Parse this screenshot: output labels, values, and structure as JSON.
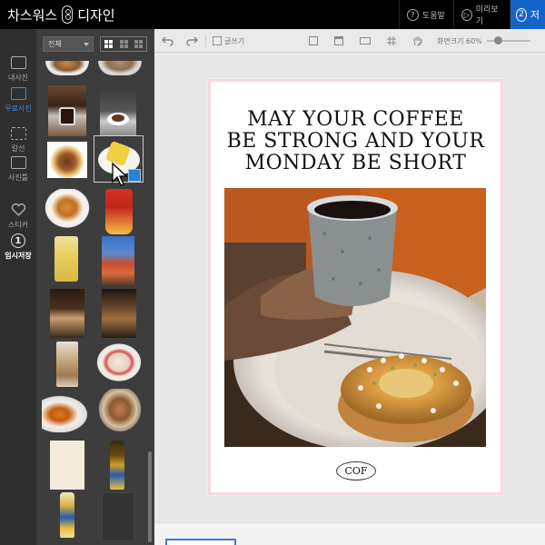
{
  "topbar": {
    "logo_left": "차스워스",
    "logo_right": "디자인",
    "help": {
      "icon": "help-icon",
      "label": "도움말"
    },
    "preview": {
      "icon": "play-icon",
      "label": "미리보기"
    },
    "save": {
      "number": "2",
      "label": "저"
    }
  },
  "leftnav": {
    "items": [
      {
        "label": "내사진",
        "icon": "camera-icon"
      },
      {
        "label": "무료사진",
        "icon": "free-photo-icon",
        "active": true
      },
      {
        "label": "칼선",
        "icon": "cut-line-icon"
      },
      {
        "label": "사진틀",
        "icon": "frame-icon"
      },
      {
        "label": "스티커",
        "icon": "heart-icon"
      },
      {
        "label": "임시저장",
        "number": "1"
      }
    ]
  },
  "panel": {
    "filter_value": "전체",
    "thumb_count": 20
  },
  "toolbar": {
    "undo": "undo-icon",
    "redo": "redo-icon",
    "text_tool": "글쓰기",
    "zoom_label": "화면크기",
    "zoom_value": "60%",
    "zoom_level": 0.25
  },
  "design": {
    "quote_lines": [
      "MAY YOUR COFFEE",
      "BE STRONG AND YOUR",
      "MONDAY BE SHORT"
    ],
    "brand": "COF",
    "border_color": "#f6d8dc"
  },
  "colors": {
    "accent": "#1464c8",
    "nav_active": "#3b8ce8"
  }
}
